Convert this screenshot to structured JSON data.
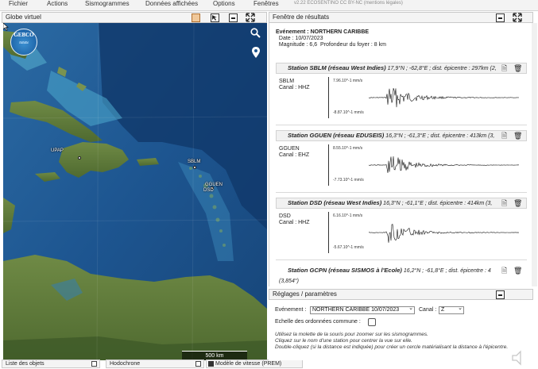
{
  "menu": [
    "Fichier",
    "Actions",
    "Sismogrammes",
    "Données affichées",
    "Options",
    "Fenêtres"
  ],
  "version_text": "v2.22 ECOSENTINO CC BY-NC   (mentions légales)",
  "globe": {
    "title": "Globe virtuel",
    "logo": "GEBCO",
    "scale": "500 km",
    "labels": [
      "UPAP",
      "SBLM",
      "GGUEN",
      "DSD"
    ]
  },
  "results": {
    "title": "Fenêtre de résultats",
    "event": {
      "line1": "Evénement : NORTHERN CARIBBE",
      "line2": "  Date : 10/07/2023",
      "line3": "  Magnitude : 6,6  Profondeur du foyer : 8 km"
    },
    "stations": [
      {
        "name": "Station SBLM (réseau West Indies)",
        "detail": " 17,9°N ; -62,8°E ; dist. épicentre : 297km (2,",
        "label": "SBLM\nCanal : HHZ",
        "amp_max": "7.96.10^-1 mm/s",
        "amp_min": "-8.87.10^-1 mm/s"
      },
      {
        "name": "Station GGUEN (réseau EDUSEIS)",
        "detail": " 16,3°N ; -61,3°E ; dist. épicentre : 413km (3,",
        "label": "GGUEN\nCanal : EHZ",
        "amp_max": "8.55.10^-1 mm/s",
        "amp_min": "-7.73.10^-1 mm/s"
      },
      {
        "name": "Station DSD (réseau West Indies)",
        "detail": " 16,3°N ; -61,1°E ; dist. épicentre : 414km (3,",
        "label": "DSD\nCanal : HHZ",
        "amp_max": "6.16.10^-1 mm/s",
        "amp_min": "-5.67.10^-1 mm/s"
      },
      {
        "name": "Station GCPN (réseau SISMOS à l'Ecole)",
        "detail": " 16,2°N ; -61,8°E ; dist. épicentre : 4",
        "partial": "(3,854°)"
      }
    ]
  },
  "settings": {
    "title": "Réglages / paramètres",
    "event_label": "Evénement :",
    "event_value": "NORTHERN CARIBBE 10/07/2023",
    "channel_label": "Canal :",
    "channel_value": "Z",
    "scale_label": "Echelle des ordonnées commune :",
    "help1": "Utilisez la molette de la souris pour zoomer sur les sismogrammes.",
    "help2": "Cliquez sur le nom d'une station pour centrer la vue sur elle.",
    "help3": "Double-cliquez (si la distance est indiquée) pour créer un cercle matérialisant la distance à l'épicentre."
  },
  "bottom_tabs": [
    "Liste des objets",
    "Hodochrone",
    "Modèle de vitesse (PREM)"
  ],
  "icons": {
    "zoom": "magnifier-icon",
    "pin": "location-pin-icon",
    "doc": "document-icon",
    "trash": "trash-icon",
    "speaker": "speaker-icon"
  },
  "colors": {
    "ocean": "#1a4e87",
    "land": "#5e7a3a",
    "accent": "#e07b39"
  }
}
